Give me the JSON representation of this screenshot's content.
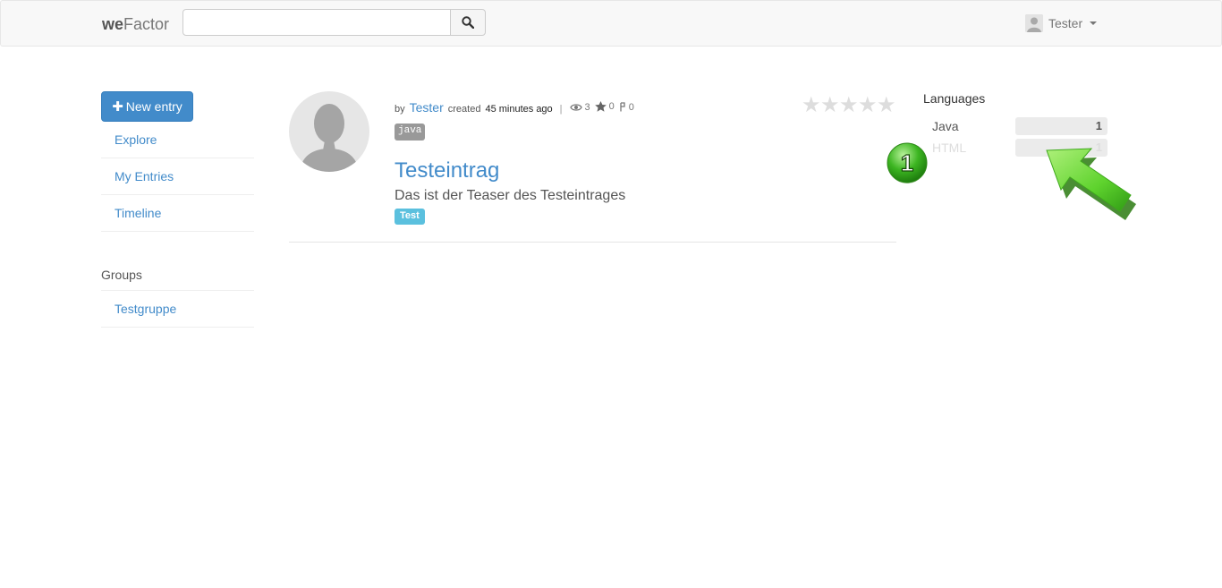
{
  "navbar": {
    "brand_bold": "we",
    "brand_rest": "Factor",
    "search_placeholder": "",
    "user_name": "Tester"
  },
  "sidebar": {
    "new_entry_label": "New entry",
    "nav_items": [
      {
        "label": "Explore"
      },
      {
        "label": "My Entries"
      },
      {
        "label": "Timeline"
      }
    ],
    "groups_heading": "Groups",
    "groups": [
      {
        "label": "Testgruppe"
      }
    ]
  },
  "entry": {
    "by_label": "by",
    "author": "Tester",
    "created_label": "created",
    "created_time": "45 minutes ago",
    "separator": "|",
    "views": "3",
    "stars": "0",
    "forks": "0",
    "language": "java",
    "title": "Testeintrag",
    "teaser": "Das ist der Teaser des Testeintrages",
    "tag": "Test",
    "rating_stars": "★★★★★"
  },
  "languages": {
    "heading": "Languages",
    "items": [
      {
        "name": "Java",
        "count": "1",
        "color": "#555555"
      },
      {
        "name": "HTML",
        "count": "1",
        "color": "#dddddd"
      }
    ]
  },
  "annotation": {
    "step_number": "1",
    "badge_color": "#3cb521",
    "arrow_color": "#5fd32e"
  },
  "colors": {
    "link": "#428bca",
    "primary_button": "#428bca",
    "tag": "#5bc0de"
  }
}
